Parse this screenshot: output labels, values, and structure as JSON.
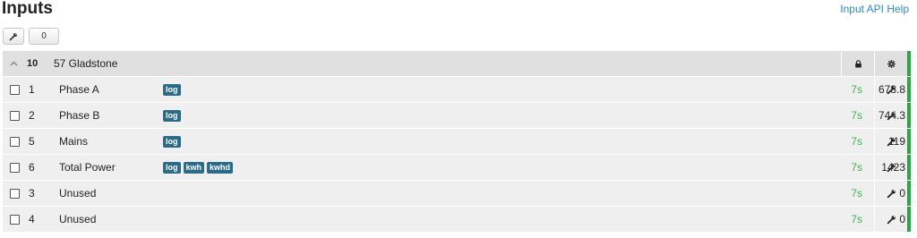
{
  "page": {
    "title": "Inputs",
    "help_link": "Input API Help"
  },
  "toolbar": {
    "selected_count": "0"
  },
  "node": {
    "id": "10",
    "name": "57 Gladstone"
  },
  "inputs": [
    {
      "id": "1",
      "name": "Phase A",
      "processes": [
        "log"
      ],
      "time": "7s",
      "value": "678.8"
    },
    {
      "id": "2",
      "name": "Phase B",
      "processes": [
        "log"
      ],
      "time": "7s",
      "value": "744.3"
    },
    {
      "id": "5",
      "name": "Mains",
      "processes": [
        "log"
      ],
      "time": "7s",
      "value": "119"
    },
    {
      "id": "6",
      "name": "Total Power",
      "processes": [
        "log",
        "kwh",
        "kwhd"
      ],
      "time": "7s",
      "value": "1423"
    },
    {
      "id": "3",
      "name": "Unused",
      "processes": [],
      "time": "7s",
      "value": "0"
    },
    {
      "id": "4",
      "name": "Unused",
      "processes": [],
      "time": "7s",
      "value": "0"
    }
  ],
  "colors": {
    "status_green": "#28a745",
    "time_green": "#3cb34c",
    "badge": "#2a6b8a",
    "link": "#2a8bc6"
  },
  "icons": {
    "toolbar_tool": "wrench-icon",
    "collapse": "chevron-up-icon",
    "lock": "lock-icon",
    "config": "gear-icon",
    "row_action": "wrench-icon"
  }
}
